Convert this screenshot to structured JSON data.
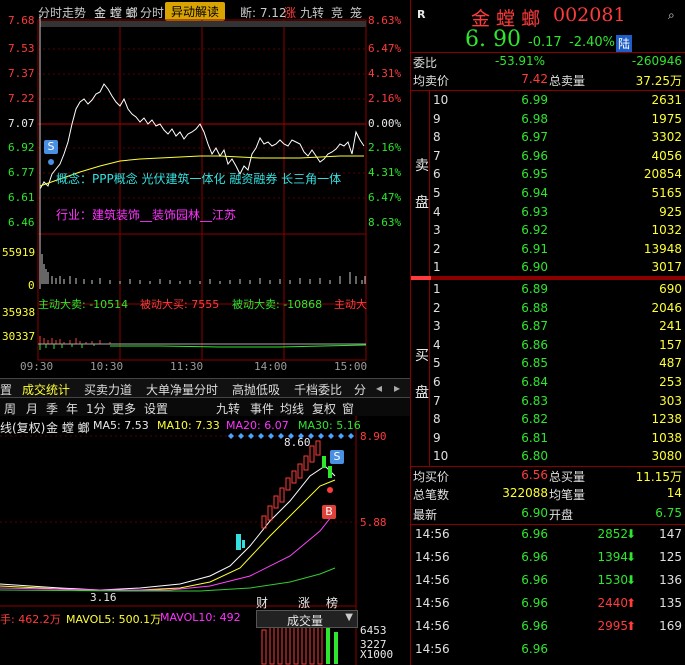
{
  "toolbar": {
    "tab_time": "分时走势",
    "stock_name": "金 螳 螂",
    "tab_time2": "分时",
    "abnormal_btn": "异动解读",
    "pre_close_label": "断: 7.12",
    "limit_up": "涨",
    "tab_nine": "九转",
    "tab_bid": "竞",
    "tab_more": "笼"
  },
  "time_chart": {
    "price_ticks": [
      "7.68",
      "7.53",
      "7.37",
      "7.22",
      "7.07",
      "6.92",
      "6.77",
      "6.61",
      "6.46"
    ],
    "pct_ticks": [
      "8.63%",
      "6.47%",
      "4.31%",
      "2.16%",
      "0.00%",
      "2.16%",
      "4.31%",
      "6.47%",
      "8.63%"
    ],
    "concept_text": "概念：PPP概念  光伏建筑一体化  融资融券  长三角一体",
    "industry_text": "行业：建筑装饰__装饰园林__江苏",
    "vol_ticks": [
      "55919",
      "0"
    ],
    "flow_label_active_sell": "主动大卖: -10514",
    "flow_label_passive_buy": "被动大买: 7555",
    "flow_label_passive_sell": "被动大卖: -10868",
    "flow_label_active_buy": "主动大",
    "flow_ticks": [
      "35938",
      "30337"
    ],
    "time_axis": [
      "09:30",
      "10:30",
      "11:30",
      "14:00",
      "15:00"
    ],
    "marker_s": "S"
  },
  "tabs1": [
    "置",
    "成交统计",
    "买卖力道",
    "大单净量分时",
    "高抛低吸",
    "千档委比",
    "分"
  ],
  "tabs2": [
    "周",
    "月",
    "季",
    "年",
    "1分",
    "更多",
    "设置",
    "九转",
    "事件",
    "均线",
    "复权",
    "窗"
  ],
  "kline": {
    "title": "线(复权)",
    "name": "金 螳 螂",
    "ma5": "MA5: 7.53",
    "ma10": "MA10: 7.33",
    "ma20": "MA20: 6.07",
    "ma30": "MA30: 5.16",
    "high_label": "8.60",
    "low_label": "3.16",
    "right_ticks": [
      "8.90",
      "5.88"
    ],
    "events": [
      "财",
      "涨",
      "榜"
    ],
    "marker_s": "S",
    "marker_b": "B",
    "vol_line": "手: 462.2万",
    "mavol5": "MAVOL5: 500.1万",
    "mavol10": "MAVOL10: 492",
    "vol_dropdown": "成交量",
    "vol_ticks": [
      "6453",
      "3227",
      "X1000"
    ]
  },
  "quote": {
    "r_icon": "R",
    "name": "金 螳 螂",
    "code": "002081",
    "price": "6. 90",
    "change": "-0.17",
    "change_pct": "-2.40%",
    "exchange_badge": "陆",
    "weibi_label": "委比",
    "weibi_pct": "-53.91%",
    "weibi_val": "-260946",
    "avg_sell_label": "均卖价",
    "avg_sell": "7.42",
    "total_sell_label": "总卖量",
    "total_sell": "37.25万",
    "sell_label_1": "卖",
    "sell_label_2": "盘",
    "buy_label_1": "买",
    "buy_label_2": "盘",
    "asks": [
      {
        "lvl": "10",
        "price": "6.99",
        "vol": "2631"
      },
      {
        "lvl": "9",
        "price": "6.98",
        "vol": "1975"
      },
      {
        "lvl": "8",
        "price": "6.97",
        "vol": "3302"
      },
      {
        "lvl": "7",
        "price": "6.96",
        "vol": "4056"
      },
      {
        "lvl": "6",
        "price": "6.95",
        "vol": "20854"
      },
      {
        "lvl": "5",
        "price": "6.94",
        "vol": "5165"
      },
      {
        "lvl": "4",
        "price": "6.93",
        "vol": "925"
      },
      {
        "lvl": "3",
        "price": "6.92",
        "vol": "1032"
      },
      {
        "lvl": "2",
        "price": "6.91",
        "vol": "13948"
      },
      {
        "lvl": "1",
        "price": "6.90",
        "vol": "3017"
      }
    ],
    "bids": [
      {
        "lvl": "1",
        "price": "6.89",
        "vol": "690"
      },
      {
        "lvl": "2",
        "price": "6.88",
        "vol": "2046"
      },
      {
        "lvl": "3",
        "price": "6.87",
        "vol": "241"
      },
      {
        "lvl": "4",
        "price": "6.86",
        "vol": "157"
      },
      {
        "lvl": "5",
        "price": "6.85",
        "vol": "487"
      },
      {
        "lvl": "6",
        "price": "6.84",
        "vol": "253"
      },
      {
        "lvl": "7",
        "price": "6.83",
        "vol": "303"
      },
      {
        "lvl": "8",
        "price": "6.82",
        "vol": "1238"
      },
      {
        "lvl": "9",
        "price": "6.81",
        "vol": "1038"
      },
      {
        "lvl": "10",
        "price": "6.80",
        "vol": "3080"
      }
    ],
    "avg_buy_label": "均买价",
    "avg_buy": "6.56",
    "total_buy_label": "总买量",
    "total_buy": "11.15万",
    "total_trades_label": "总笔数",
    "total_trades": "322088",
    "avg_trade_label": "均笔量",
    "avg_trade": "14",
    "last_label": "最新",
    "last": "6.90",
    "open_label": "开盘",
    "open": "6.75",
    "ticks": [
      {
        "time": "14:56",
        "price": "6.96",
        "vol": "2852",
        "dir": "down",
        "cnt": "147"
      },
      {
        "time": "14:56",
        "price": "6.96",
        "vol": "1394",
        "dir": "down",
        "cnt": "125"
      },
      {
        "time": "14:56",
        "price": "6.96",
        "vol": "1530",
        "dir": "down",
        "cnt": "136"
      },
      {
        "time": "14:56",
        "price": "6.96",
        "vol": "2440",
        "dir": "up",
        "cnt": "135"
      },
      {
        "time": "14:56",
        "price": "6.96",
        "vol": "2995",
        "dir": "up",
        "cnt": "169"
      },
      {
        "time": "14:56",
        "price": "6.96",
        "vol": "",
        "dir": "",
        "cnt": ""
      }
    ]
  },
  "colors": {
    "up": "#ff3b3b",
    "down": "#2ee62e",
    "accent": "#ffff33",
    "frame": "#8a0000"
  }
}
